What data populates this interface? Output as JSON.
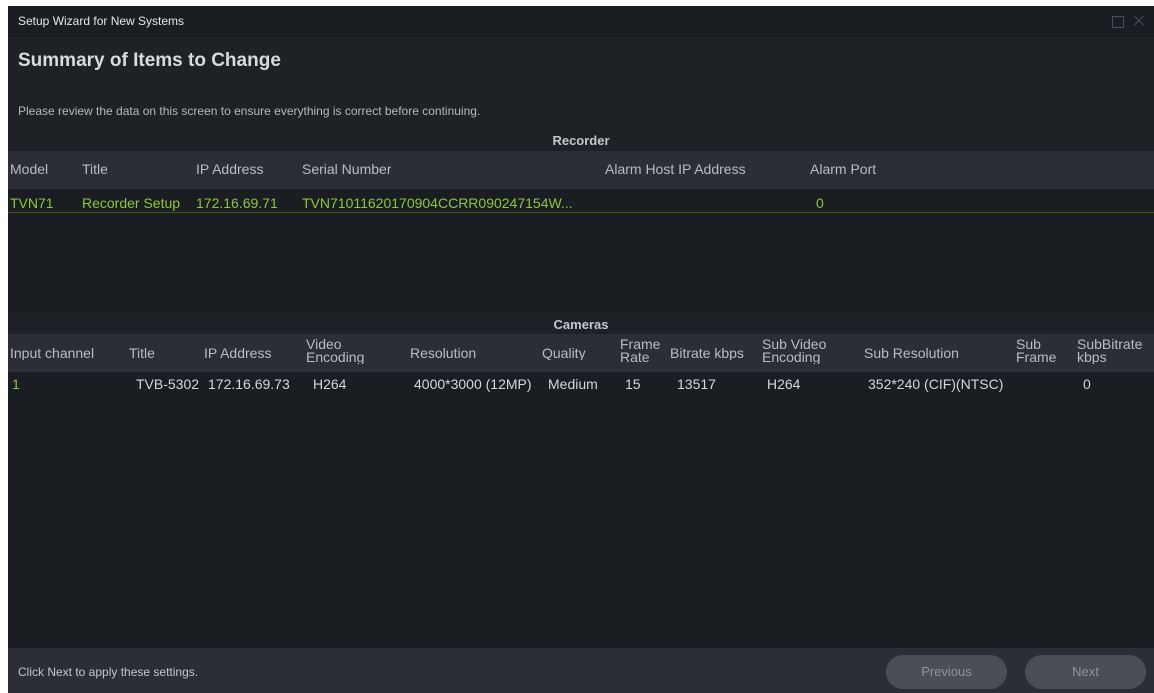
{
  "window": {
    "title": "Setup Wizard for New Systems"
  },
  "page": {
    "title": "Summary of Items to Change",
    "instruction": "Please review the data on this screen to ensure everything is correct before continuing."
  },
  "recorder": {
    "section_title": "Recorder",
    "columns": [
      "Model",
      "Title",
      "IP Address",
      "Serial Number",
      "Alarm Host IP Address",
      "Alarm Port"
    ],
    "rows": [
      {
        "model": "TVN71",
        "title": "Recorder Setup",
        "ip": "172.16.69.71",
        "serial": "TVN71011620170904CCRR090247154W...",
        "alarm_host": "",
        "alarm_port": "0"
      }
    ]
  },
  "cameras": {
    "section_title": "Cameras",
    "columns": [
      "Input channel",
      "Title",
      "IP Address",
      "Video Encoding",
      "Resolution",
      "Quality",
      "Frame Rate",
      "Bitrate kbps",
      "Sub Video Encoding",
      "Sub Resolution",
      "Sub Frame",
      "SubBitrate kbps"
    ],
    "rows": [
      {
        "input": "1",
        "title": "TVB-5302",
        "ip": "172.16.69.73",
        "encoding": "H264",
        "resolution": "4000*3000 (12MP)",
        "quality": "Medium",
        "frame_rate": "15",
        "bitrate": "13517",
        "sub_encoding": "H264",
        "sub_resolution": "352*240 (CIF)(NTSC)",
        "sub_frame": "",
        "sub_bitrate": "0"
      }
    ]
  },
  "footer": {
    "hint": "Click Next to apply these settings.",
    "previous_label": "Previous",
    "next_label": "Next"
  },
  "colors": {
    "accent_green": "#8cc63f",
    "background": "#1e2126",
    "header_bg": "#2b2f35",
    "button_bg": "#4a4f57"
  }
}
